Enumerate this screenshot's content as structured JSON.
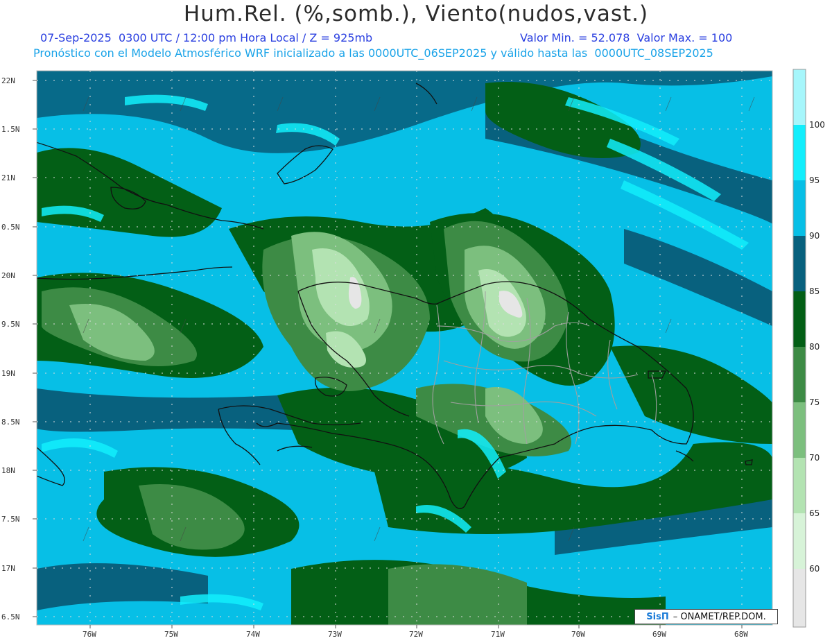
{
  "header": {
    "title": "Hum.Rel. (%,somb.), Viento(nudos,vast.)",
    "datetime": "07-Sep-2025  0300 UTC / 12:00 pm Hora Local / Z = 925mb",
    "minmax": "Valor Min. = 52.078  Valor Max. = 100",
    "model_info": "Pronóstico con el Modelo Atmosférico WRF inicializado a las 0000UTC_06SEP2025 y válido hasta las  0000UTC_08SEP2025"
  },
  "axes": {
    "lat_labels": [
      "22N",
      "1.5N",
      "21N",
      "0.5N",
      "20N",
      "9.5N",
      "19N",
      "8.5N",
      "18N",
      "7.5N",
      "17N",
      "6.5N"
    ],
    "lon_labels": [
      "76W",
      "75W",
      "74W",
      "73W",
      "72W",
      "71W",
      "70W",
      "69W",
      "68W"
    ]
  },
  "colorbar": {
    "labels": [
      "100",
      "95",
      "90",
      "85",
      "80",
      "75",
      "70",
      "65",
      "60"
    ],
    "colors": [
      "#a6f6fb",
      "#12eefc",
      "#07bfe6",
      "#08617e",
      "#035f16",
      "#3d8b45",
      "#7cbf7e",
      "#b3e3b2",
      "#d7f3d8",
      "#e6e6e6"
    ]
  },
  "credit": {
    "logo": "SisΠ",
    "text": "– ONAMET/REP.DOM."
  }
}
